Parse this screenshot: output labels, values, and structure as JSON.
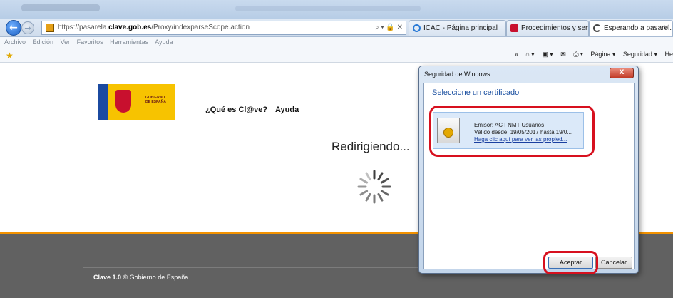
{
  "browser": {
    "address": {
      "prefix": "https://pasarela.",
      "domain": "clave.gob.es",
      "path": "/Proxy/indexparseScope.action",
      "tools": "⌕ ▾ 🔒 ✕"
    },
    "tabs": [
      {
        "label": "ICAC - Página principal",
        "icon": "ie-icon",
        "color": "#2b7bd6"
      },
      {
        "label": "Procedimientos y servi...",
        "icon": "ministry-icon",
        "color": "#c8102e"
      },
      {
        "label": "Esperando a pasarel...",
        "icon": "loading-icon",
        "color": "#444444"
      }
    ],
    "tab_close": "✕",
    "menu": [
      "Archivo",
      "Edición",
      "Ver",
      "Favoritos",
      "Herramientas",
      "Ayuda"
    ],
    "command_bar": [
      "»",
      "⌂ ▾",
      "▣ ▾",
      "✉",
      "⎙ ▾",
      "Página ▾",
      "Seguridad ▾",
      "He"
    ]
  },
  "page": {
    "logo_text": "GOBIERNO\nDE ESPAÑA",
    "links": {
      "que_es": "¿Qué es Cl@ve?",
      "ayuda": "Ayuda"
    },
    "status": "Redirigiendo...",
    "footer": {
      "brand": "Clave 1.0",
      "rest": " © Gobierno de España"
    },
    "colors": {
      "accent": "#f39200",
      "footer_bg": "#616161"
    }
  },
  "dialog": {
    "title": "Seguridad de Windows",
    "close": "X",
    "heading": "Seleccione un certificado",
    "certificate": {
      "issuer": "Emisor: AC FNMT Usuarios",
      "valid": "Válido desde: 19/05/2017 hasta 19/0...",
      "link": "Haga clic aquí para ver las propied..."
    },
    "buttons": {
      "accept": "Aceptar",
      "cancel": "Cancelar"
    },
    "highlight_color": "#d7101e"
  }
}
